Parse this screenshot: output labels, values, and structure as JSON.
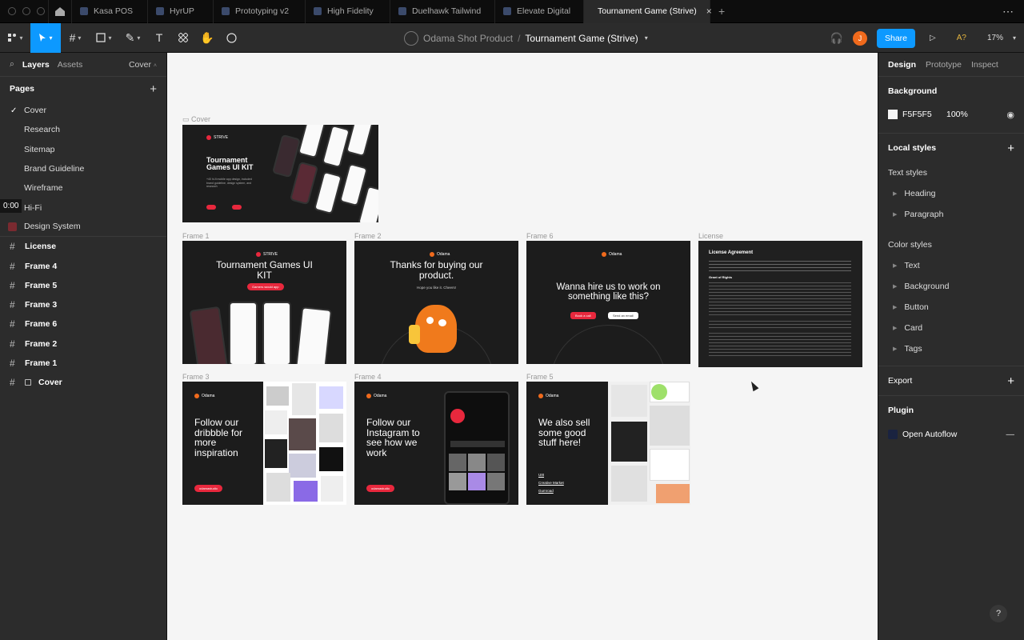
{
  "tabs": [
    {
      "label": "Kasa POS"
    },
    {
      "label": "HyrUP"
    },
    {
      "label": "Prototyping v2"
    },
    {
      "label": "High Fidelity"
    },
    {
      "label": "Duelhawk Tailwind"
    },
    {
      "label": "Elevate Digital"
    },
    {
      "label": "Tournament Game (Strive)",
      "active": true
    }
  ],
  "toolbar": {
    "project": "Odama Shot Product",
    "separator": "/",
    "file": "Tournament Game (Strive)",
    "share": "Share",
    "user_initial": "J",
    "font_missing": "A?",
    "zoom": "17%"
  },
  "left": {
    "tab_layers": "Layers",
    "tab_assets": "Assets",
    "current_page": "Cover",
    "pages_title": "Pages",
    "pages": [
      "Cover",
      "Research",
      "Sitemap",
      "Brand Guideline",
      "Wireframe",
      "Hi-Fi",
      "Design System"
    ],
    "timestamp": "0:00",
    "layers": [
      {
        "label": "License"
      },
      {
        "label": "Frame 4"
      },
      {
        "label": "Frame 5"
      },
      {
        "label": "Frame 3"
      },
      {
        "label": "Frame 6"
      },
      {
        "label": "Frame 2"
      },
      {
        "label": "Frame 1"
      },
      {
        "label": "Cover",
        "frame_icon": true
      }
    ]
  },
  "canvas": {
    "labels": {
      "cover": "Cover",
      "f1": "Frame 1",
      "f2": "Frame 2",
      "f6": "Frame 6",
      "license": "License",
      "f3": "Frame 3",
      "f4": "Frame 4",
      "f5": "Frame 5"
    },
    "cover": {
      "brand": "STRIVE",
      "title": "Tournament Games UI KIT",
      "sub": "+40 hi-fi mobile app design, included brand guideline, design system, and research"
    },
    "f1": {
      "brand": "STRIVE",
      "title": "Tournament Games UI KIT",
      "pill": "Gamers would app"
    },
    "f2": {
      "brand": "Odama",
      "title": "Thanks for buying our product.",
      "sub": "Hope you like it. Cheers!"
    },
    "f6": {
      "brand": "Odama",
      "title": "Wanna hire us to work on something like this?",
      "btn1": "Book a call",
      "btn2": "Send an email"
    },
    "license": {
      "title": "License Agreement",
      "heading": "Grant of Rights"
    },
    "f3": {
      "brand": "Odama",
      "title": "Follow our dribbble for more inspiration",
      "pill": "odamastudio"
    },
    "f4": {
      "brand": "Odama",
      "title": "Follow our Instagram to see how we work",
      "pill": "odamastudio"
    },
    "f5": {
      "brand": "Odama",
      "title": "We also sell some good stuff here!",
      "links": [
        "UI8",
        "Creative Market",
        "Gumroad"
      ]
    }
  },
  "right": {
    "tabs": [
      "Design",
      "Prototype",
      "Inspect"
    ],
    "background_title": "Background",
    "bg_hex": "F5F5F5",
    "bg_opacity": "100%",
    "local_styles": "Local styles",
    "text_styles": "Text styles",
    "text_items": [
      "Heading",
      "Paragraph"
    ],
    "color_styles": "Color styles",
    "color_items": [
      "Text",
      "Background",
      "Button",
      "Card",
      "Tags"
    ],
    "export": "Export",
    "plugin": "Plugin",
    "plugin_item": "Open Autoflow"
  },
  "help": "?"
}
